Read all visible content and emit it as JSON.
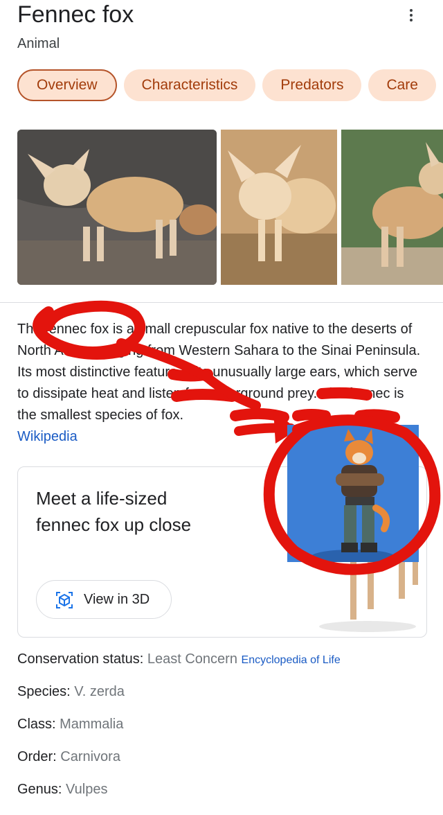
{
  "header": {
    "title": "Fennec fox",
    "subtitle": "Animal"
  },
  "tabs": [
    {
      "label": "Overview",
      "active": true
    },
    {
      "label": "Characteristics",
      "active": false
    },
    {
      "label": "Predators",
      "active": false
    },
    {
      "label": "Care",
      "active": false
    }
  ],
  "description": {
    "text": "The fennec fox is a small crepuscular fox native to the deserts of North Africa, ranging from Western Sahara to the Sinai Peninsula. Its most distinctive feature is its unusually large ears, which serve to dissipate heat and listen for underground prey. The fennec is the smallest species of fox.",
    "source": "Wikipedia"
  },
  "card": {
    "title": "Meet a life-sized fennec fox up close",
    "button_label": "View in 3D"
  },
  "facts": [
    {
      "label": "Conservation status: ",
      "value": "Least Concern",
      "source": "Encyclopedia of Life"
    },
    {
      "label": "Species: ",
      "value": "V. zerda"
    },
    {
      "label": "Class: ",
      "value": "Mammalia"
    },
    {
      "label": "Order: ",
      "value": "Carnivora"
    },
    {
      "label": "Genus: ",
      "value": "Vulpes"
    }
  ],
  "colors": {
    "tab_bg": "#fde2d1",
    "tab_text": "#a23c0b",
    "link": "#1a5bc4",
    "annotation_red": "#e3140d"
  },
  "icons": [
    "more-vert-icon",
    "view-in-3d-icon"
  ]
}
